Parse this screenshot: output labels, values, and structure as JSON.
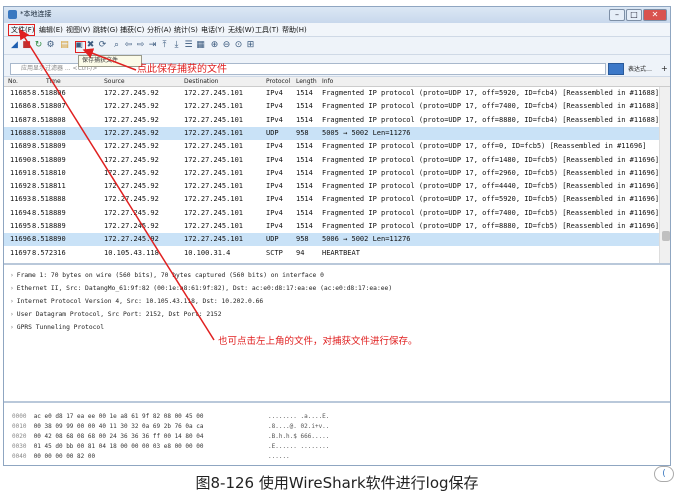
{
  "window": {
    "title": "*本地连接",
    "btn_min": "–",
    "btn_max": "□",
    "btn_close": "✕"
  },
  "menu": [
    "文件(F)",
    "编辑(E)",
    "视图(V)",
    "跳转(G)",
    "捕获(C)",
    "分析(A)",
    "统计(S)",
    "电话(Y)",
    "无线(W)",
    "工具(T)",
    "帮助(H)"
  ],
  "tooltip": "保存捕获文件",
  "filter": {
    "placeholder": "应用显示过滤器 ... <Ctrl-/>",
    "expression_label": "表达式…",
    "plus": "+"
  },
  "annotations": {
    "save_hint": "点此保存捕获的文件",
    "corner_hint": "也可点击左上角的文件，对捕获文件进行保存。"
  },
  "packet_list": {
    "columns": {
      "no": "No.",
      "time": "Time",
      "source": "Source",
      "destination": "Destination",
      "protocol": "Protocol",
      "length": "Length",
      "info": "Info"
    },
    "rows": [
      {
        "no": "11685",
        "time": "8.518806",
        "src": "172.27.245.92",
        "dst": "172.27.245.101",
        "proto": "IPv4",
        "len": "1514",
        "info": "Fragmented IP protocol (proto=UDP 17, off=5920, ID=fcb4) [Reassembled in #11688]"
      },
      {
        "no": "11686",
        "time": "8.518807",
        "src": "172.27.245.92",
        "dst": "172.27.245.101",
        "proto": "IPv4",
        "len": "1514",
        "info": "Fragmented IP protocol (proto=UDP 17, off=7400, ID=fcb4) [Reassembled in #11688]"
      },
      {
        "no": "11687",
        "time": "8.518808",
        "src": "172.27.245.92",
        "dst": "172.27.245.101",
        "proto": "IPv4",
        "len": "1514",
        "info": "Fragmented IP protocol (proto=UDP 17, off=8880, ID=fcb4) [Reassembled in #11688]"
      },
      {
        "no": "11688",
        "time": "8.518808",
        "src": "172.27.245.92",
        "dst": "172.27.245.101",
        "proto": "UDP",
        "len": "958",
        "info": "5005 → 5002 Len=11276"
      },
      {
        "no": "11689",
        "time": "8.518809",
        "src": "172.27.245.92",
        "dst": "172.27.245.101",
        "proto": "IPv4",
        "len": "1514",
        "info": "Fragmented IP protocol (proto=UDP 17, off=0, ID=fcb5) [Reassembled in #11696]"
      },
      {
        "no": "11690",
        "time": "8.518809",
        "src": "172.27.245.92",
        "dst": "172.27.245.101",
        "proto": "IPv4",
        "len": "1514",
        "info": "Fragmented IP protocol (proto=UDP 17, off=1480, ID=fcb5) [Reassembled in #11696]"
      },
      {
        "no": "11691",
        "time": "8.518810",
        "src": "172.27.245.92",
        "dst": "172.27.245.101",
        "proto": "IPv4",
        "len": "1514",
        "info": "Fragmented IP protocol (proto=UDP 17, off=2960, ID=fcb5) [Reassembled in #11696]"
      },
      {
        "no": "11692",
        "time": "8.518811",
        "src": "172.27.245.92",
        "dst": "172.27.245.101",
        "proto": "IPv4",
        "len": "1514",
        "info": "Fragmented IP protocol (proto=UDP 17, off=4440, ID=fcb5) [Reassembled in #11696]"
      },
      {
        "no": "11693",
        "time": "8.518888",
        "src": "172.27.245.92",
        "dst": "172.27.245.101",
        "proto": "IPv4",
        "len": "1514",
        "info": "Fragmented IP protocol (proto=UDP 17, off=5920, ID=fcb5) [Reassembled in #11696]"
      },
      {
        "no": "11694",
        "time": "8.518889",
        "src": "172.27.245.92",
        "dst": "172.27.245.101",
        "proto": "IPv4",
        "len": "1514",
        "info": "Fragmented IP protocol (proto=UDP 17, off=7400, ID=fcb5) [Reassembled in #11696]"
      },
      {
        "no": "11695",
        "time": "8.518889",
        "src": "172.27.245.92",
        "dst": "172.27.245.101",
        "proto": "IPv4",
        "len": "1514",
        "info": "Fragmented IP protocol (proto=UDP 17, off=8880, ID=fcb5) [Reassembled in #11696]"
      },
      {
        "no": "11696",
        "time": "8.518890",
        "src": "172.27.245.92",
        "dst": "172.27.245.101",
        "proto": "UDP",
        "len": "958",
        "info": "5006 → 5002 Len=11276"
      },
      {
        "no": "11697",
        "time": "8.572316",
        "src": "10.105.43.118",
        "dst": "10.100.31.4",
        "proto": "SCTP",
        "len": "94",
        "info": "HEARTBEAT"
      }
    ]
  },
  "details": [
    "Frame 1: 70 bytes on wire (560 bits), 70 bytes captured (560 bits) on interface 0",
    "Ethernet II, Src: DatangMo_61:9f:82 (00:1e:a8:61:9f:82), Dst: ac:e0:d8:17:ea:ee (ac:e0:d8:17:ea:ee)",
    "Internet Protocol Version 4, Src: 10.105.43.118, Dst: 10.202.0.66",
    "User Datagram Protocol, Src Port: 2152, Dst Port: 2152",
    "GPRS Tunneling Protocol"
  ],
  "hex": [
    {
      "off": "0000",
      "bytes": "ac e0 d8 17 ea ee 00 1e  a8 61 9f 82 08 00 45 00",
      "ascii": "........ .a....E."
    },
    {
      "off": "0010",
      "bytes": "00 38 09 99 00 00 40 11  30 32 0a 69 2b 76 0a ca",
      "ascii": ".8....@. 02.i+v.."
    },
    {
      "off": "0020",
      "bytes": "00 42 08 68 08 68 00 24  36 36 36 ff 00 14 80 04",
      "ascii": ".B.h.h.$ 666....."
    },
    {
      "off": "0030",
      "bytes": "01 45 d0 bb 00 81 04 18  00 00 00 03 e8 00 00 00",
      "ascii": ".E...... ........"
    },
    {
      "off": "0040",
      "bytes": "00 00 00 00 82 00",
      "ascii": "......"
    }
  ],
  "caption": "图8-126   使用WireShark软件进行log保存",
  "colors": {
    "annotation": "#e02020",
    "selected_row": "#c9e2f7"
  }
}
